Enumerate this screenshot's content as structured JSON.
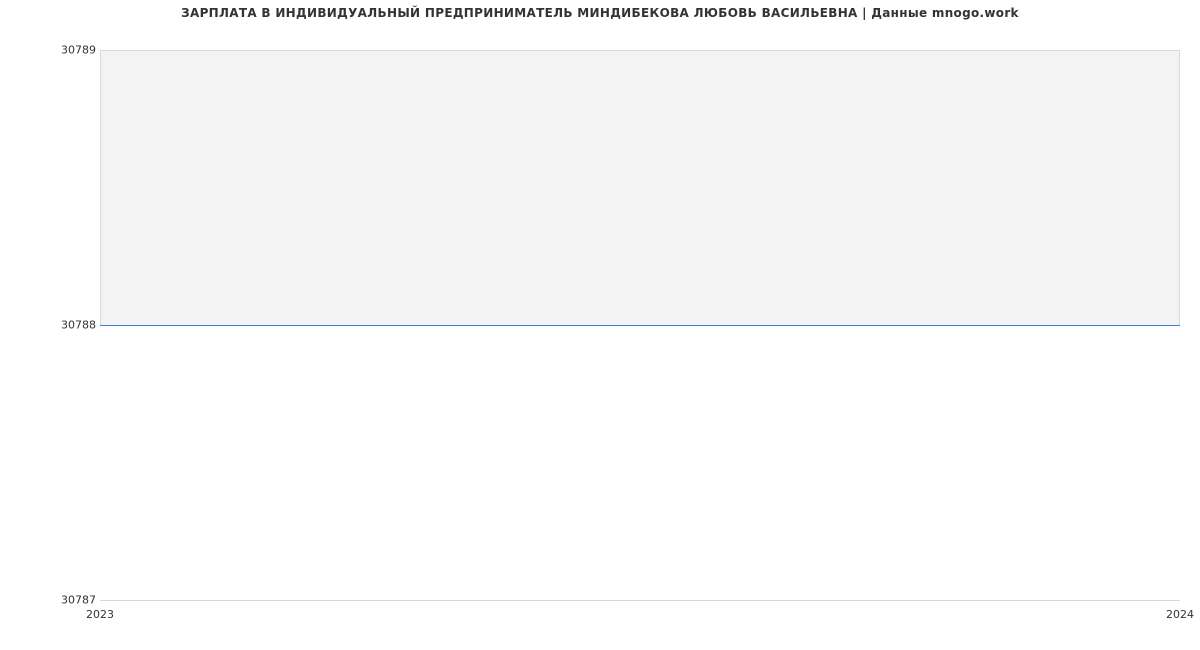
{
  "chart_data": {
    "type": "area",
    "title": "ЗАРПЛАТА В ИНДИВИДУАЛЬНЫЙ ПРЕДПРИНИМАТЕЛЬ МИНДИБЕКОВА ЛЮБОВЬ ВАСИЛЬЕВНА | Данные mnogo.work",
    "xlabel": "",
    "ylabel": "",
    "x": [
      2023,
      2024
    ],
    "values": [
      30788,
      30788
    ],
    "ylim": [
      30787,
      30789
    ],
    "xlim": [
      2023,
      2024
    ],
    "y_ticks": [
      30787,
      30788,
      30789
    ],
    "x_ticks": [
      2023,
      2024
    ],
    "colors": {
      "line": "#3b7dd8",
      "fill": "#f3f3f3",
      "grid": "#d9d9d9"
    }
  },
  "ticks": {
    "y_top": "30789",
    "y_mid": "30788",
    "y_bottom": "30787",
    "x_left": "2023",
    "x_right": "2024"
  }
}
